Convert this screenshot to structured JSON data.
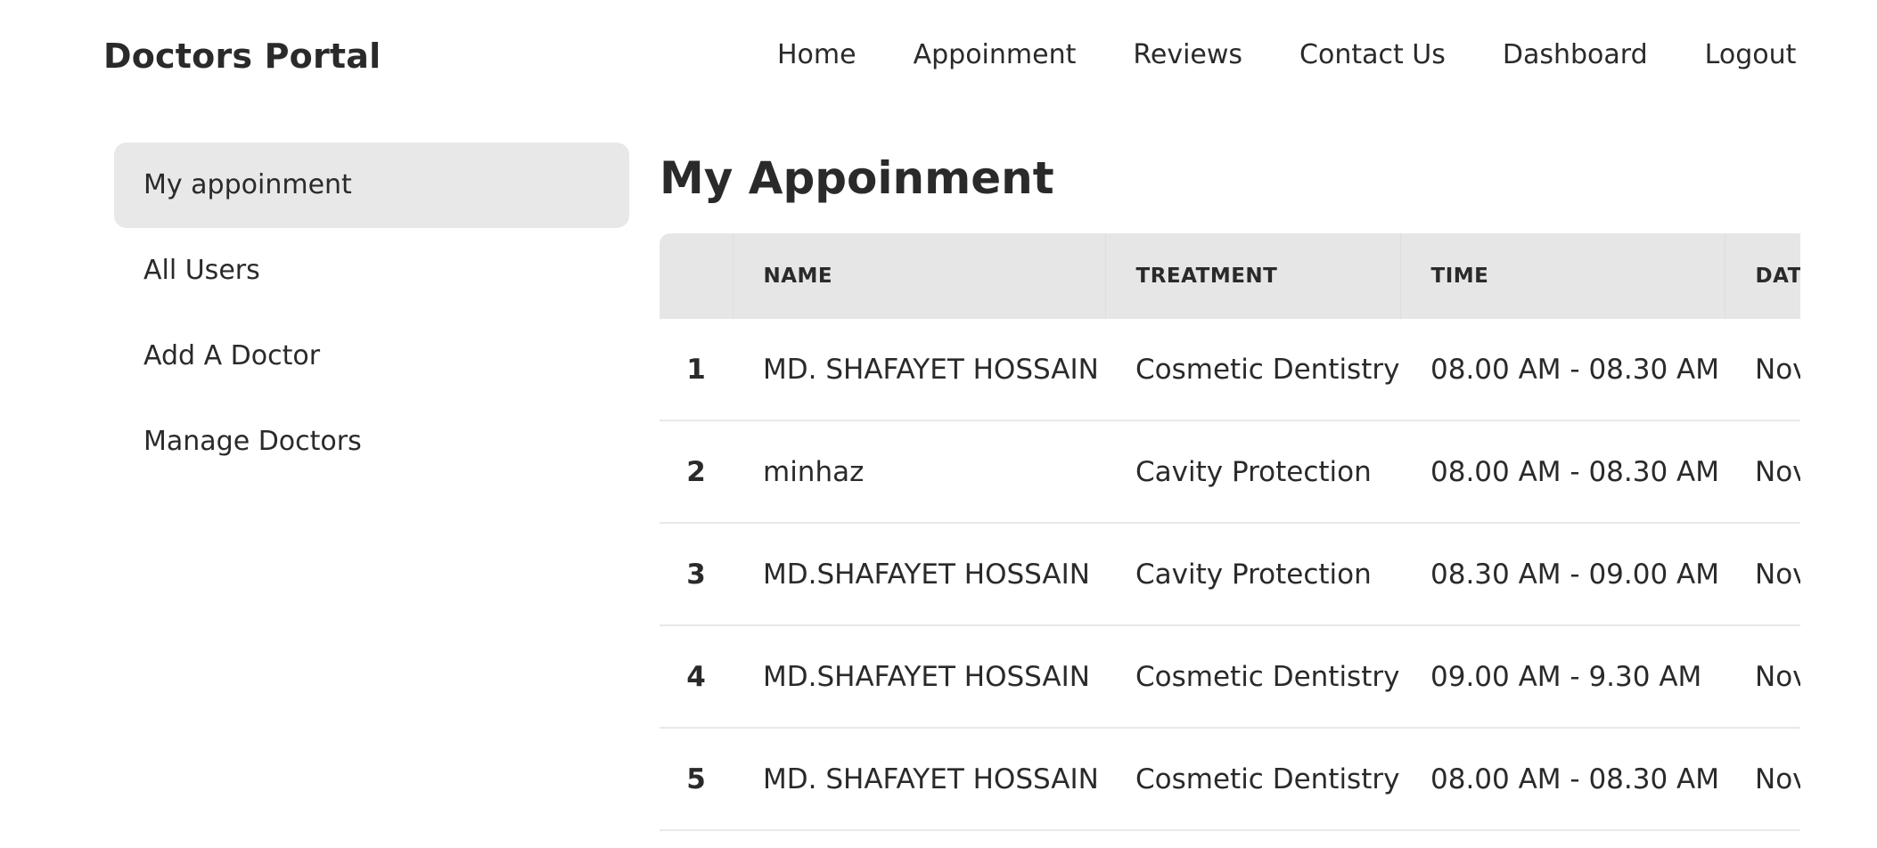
{
  "brand": "Doctors Portal",
  "nav": {
    "items": [
      {
        "label": "Home"
      },
      {
        "label": "Appoinment"
      },
      {
        "label": "Reviews"
      },
      {
        "label": "Contact Us"
      },
      {
        "label": "Dashboard"
      },
      {
        "label": "Logout"
      }
    ]
  },
  "sidebar": {
    "items": [
      {
        "label": "My appoinment",
        "active": true
      },
      {
        "label": "All Users"
      },
      {
        "label": "Add A Doctor"
      },
      {
        "label": "Manage Doctors"
      }
    ]
  },
  "main": {
    "title": "My Appoinment",
    "table": {
      "headers": [
        "",
        "NAME",
        "TREATMENT",
        "TIME",
        "DATE"
      ],
      "rows": [
        {
          "index": "1",
          "name": "MD. SHAFAYET HOSSAIN",
          "treatment": "Cosmetic Dentistry",
          "time": "08.00 AM - 08.30 AM",
          "date": "Nov"
        },
        {
          "index": "2",
          "name": "minhaz",
          "treatment": "Cavity Protection",
          "time": "08.00 AM - 08.30 AM",
          "date": "Nov"
        },
        {
          "index": "3",
          "name": "MD.SHAFAYET HOSSAIN",
          "treatment": "Cavity Protection",
          "time": "08.30 AM - 09.00 AM",
          "date": "Nov"
        },
        {
          "index": "4",
          "name": "MD.SHAFAYET HOSSAIN",
          "treatment": "Cosmetic Dentistry",
          "time": "09.00 AM - 9.30 AM",
          "date": "Nov"
        },
        {
          "index": "5",
          "name": "MD. SHAFAYET HOSSAIN",
          "treatment": "Cosmetic Dentistry",
          "time": "08.00 AM - 08.30 AM",
          "date": "Nov"
        }
      ]
    }
  }
}
